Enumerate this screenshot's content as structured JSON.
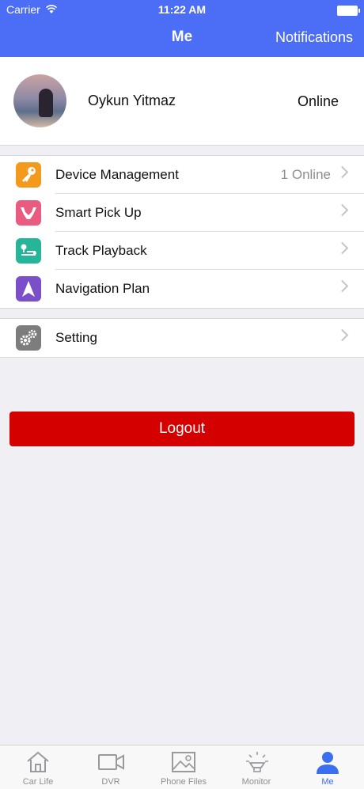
{
  "status_bar": {
    "carrier": "Carrier",
    "time": "11:22 AM"
  },
  "header": {
    "title": "Me",
    "notifications_label": "Notifications"
  },
  "profile": {
    "name": "Oykun Yitmaz",
    "status": "Online"
  },
  "menu_group_1": [
    {
      "label": "Device Management",
      "detail": "1 Online",
      "icon": "key-icon",
      "color": "#f39a1c"
    },
    {
      "label": "Smart  Pick Up",
      "detail": "",
      "icon": "hands-icon",
      "color": "#ea5c7f"
    },
    {
      "label": "Track Playback",
      "detail": "",
      "icon": "route-icon",
      "color": "#25b69a"
    },
    {
      "label": "Navigation Plan",
      "detail": "",
      "icon": "navigation-arrow-icon",
      "color": "#7a4fc9"
    }
  ],
  "menu_group_2": [
    {
      "label": "Setting",
      "icon": "gears-icon",
      "color": "#7d7d7d"
    }
  ],
  "logout_label": "Logout",
  "tabs": [
    {
      "label": "Car Life",
      "icon": "house-icon"
    },
    {
      "label": "DVR",
      "icon": "video-camera-icon"
    },
    {
      "label": "Phone Files",
      "icon": "image-icon"
    },
    {
      "label": "Monitor",
      "icon": "lamp-icon"
    },
    {
      "label": "Me",
      "icon": "person-icon",
      "active": true
    }
  ],
  "colors": {
    "header": "#4c6ef6",
    "logout": "#d40000",
    "active_tab": "#3b6ff0"
  }
}
